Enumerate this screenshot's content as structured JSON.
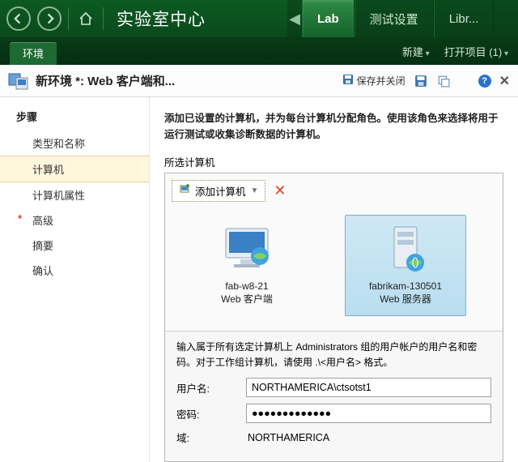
{
  "app": {
    "title": "实验室中心"
  },
  "sys": {
    "minimize": "—",
    "maximize": "☐",
    "close": "✕"
  },
  "topTabs": {
    "active": "Lab",
    "tab2": "测试设置",
    "tab3": "Libr..."
  },
  "subbar": {
    "tab": "环境",
    "new": "新建",
    "open": "打开项目 (1)"
  },
  "editor": {
    "title": "新环境 *: Web 客户端和...",
    "saveClose": "保存并关闭"
  },
  "steps": {
    "heading": "步骤",
    "items": [
      {
        "label": "类型和名称",
        "required": false,
        "selected": false
      },
      {
        "label": "计算机",
        "required": false,
        "selected": true
      },
      {
        "label": "计算机属性",
        "required": false,
        "selected": false
      },
      {
        "label": "高级",
        "required": true,
        "selected": false
      },
      {
        "label": "摘要",
        "required": false,
        "selected": false
      },
      {
        "label": "确认",
        "required": false,
        "selected": false
      }
    ]
  },
  "main": {
    "intro": "添加已设置的计算机，并为每台计算机分配角色。使用该角色来选择将用于运行测试或收集诊断数据的计算机。",
    "groupLabel": "所选计算机",
    "addButton": "添加计算机",
    "tiles": [
      {
        "name": "fab-w8-21",
        "role": "Web 客户端",
        "selected": false,
        "icon": "monitor"
      },
      {
        "name": "fabrikam-130501",
        "role": "Web 服务器",
        "selected": true,
        "icon": "server"
      }
    ],
    "cred": {
      "intro": "输入属于所有选定计算机上 Administrators 组的用户帐户的用户名和密码。对于工作组计算机，请使用 .\\<用户名> 格式。",
      "userLabel": "用户名:",
      "userValue": "NORTHAMERICA\\ctsotst1",
      "passLabel": "密码:",
      "passValue": "●●●●●●●●●●●●●",
      "domainLabel": "域:",
      "domainValue": "NORTHAMERICA"
    }
  }
}
